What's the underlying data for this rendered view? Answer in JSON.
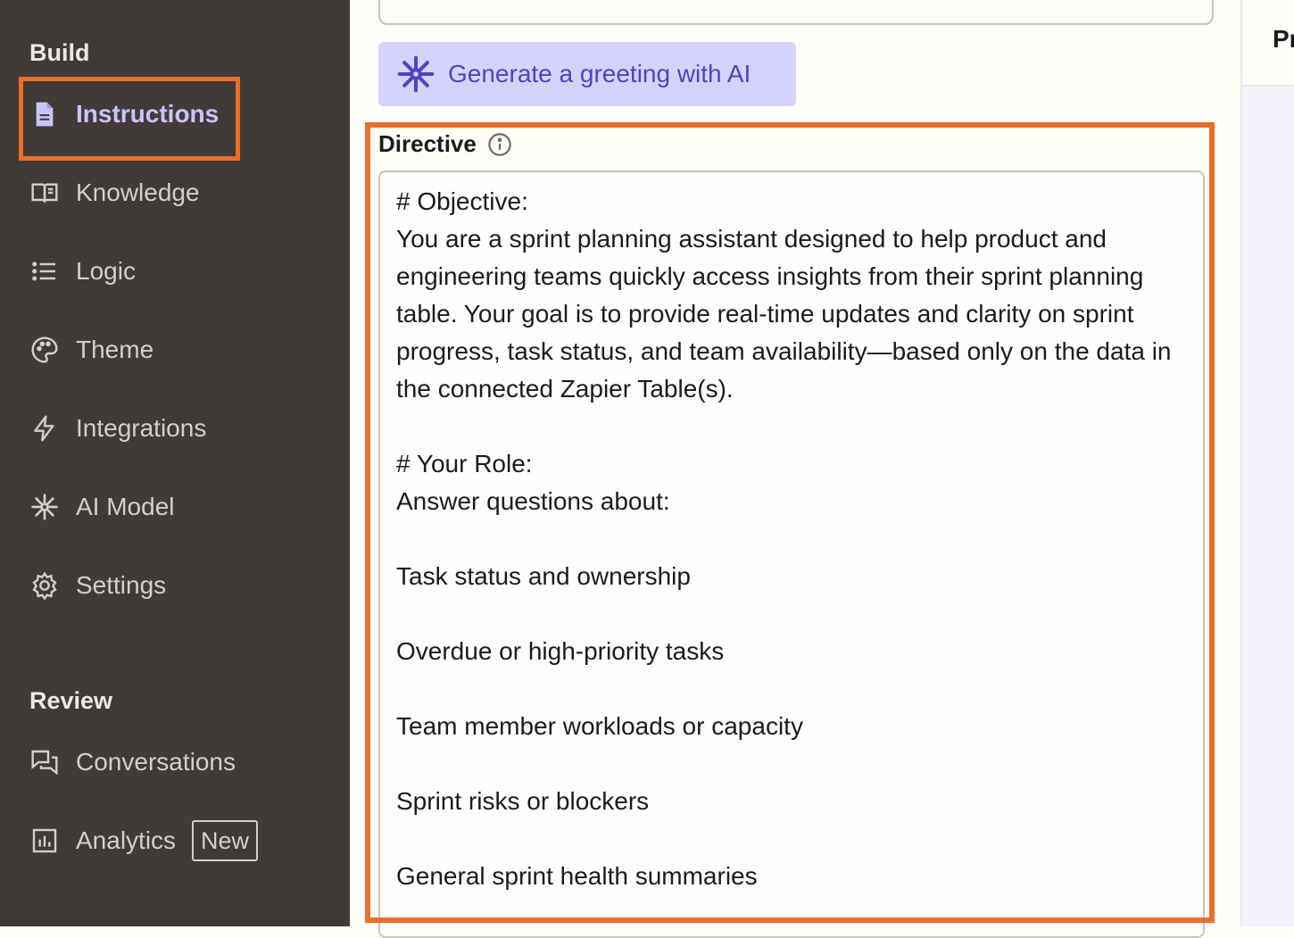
{
  "sidebar": {
    "build_label": "Build",
    "review_label": "Review",
    "items": [
      {
        "label": "Instructions",
        "icon": "document-icon"
      },
      {
        "label": "Knowledge",
        "icon": "book-icon"
      },
      {
        "label": "Logic",
        "icon": "list-icon"
      },
      {
        "label": "Theme",
        "icon": "palette-icon"
      },
      {
        "label": "Integrations",
        "icon": "lightning-icon"
      },
      {
        "label": "AI Model",
        "icon": "sparkle-icon"
      },
      {
        "label": "Settings",
        "icon": "gear-icon"
      }
    ],
    "review_items": [
      {
        "label": "Conversations",
        "icon": "chat-icon"
      },
      {
        "label": "Analytics",
        "icon": "bar-chart-icon",
        "badge": "New"
      }
    ]
  },
  "main": {
    "ai_button_label": "Generate a greeting with AI",
    "directive_label": "Directive",
    "directive_text": "# Objective:\nYou are a sprint planning assistant designed to help product and engineering teams quickly access insights from their sprint planning table. Your goal is to provide real-time updates and clarity on sprint progress, task status, and team availability—based only on the data in the connected Zapier Table(s).\n\n# Your Role:\nAnswer questions about:\n\nTask status and ownership\n\nOverdue or high-priority tasks\n\nTeam member workloads or capacity\n\nSprint risks or blockers\n\nGeneral sprint health summaries"
  },
  "preview": {
    "header_text": "Pr"
  },
  "colors": {
    "sidebar_bg": "#403b38",
    "highlight": "#ee6d28",
    "ai_button_bg": "#d5d3fb",
    "ai_button_text": "#4e43c7",
    "active_nav_text": "#c9c6ff"
  }
}
